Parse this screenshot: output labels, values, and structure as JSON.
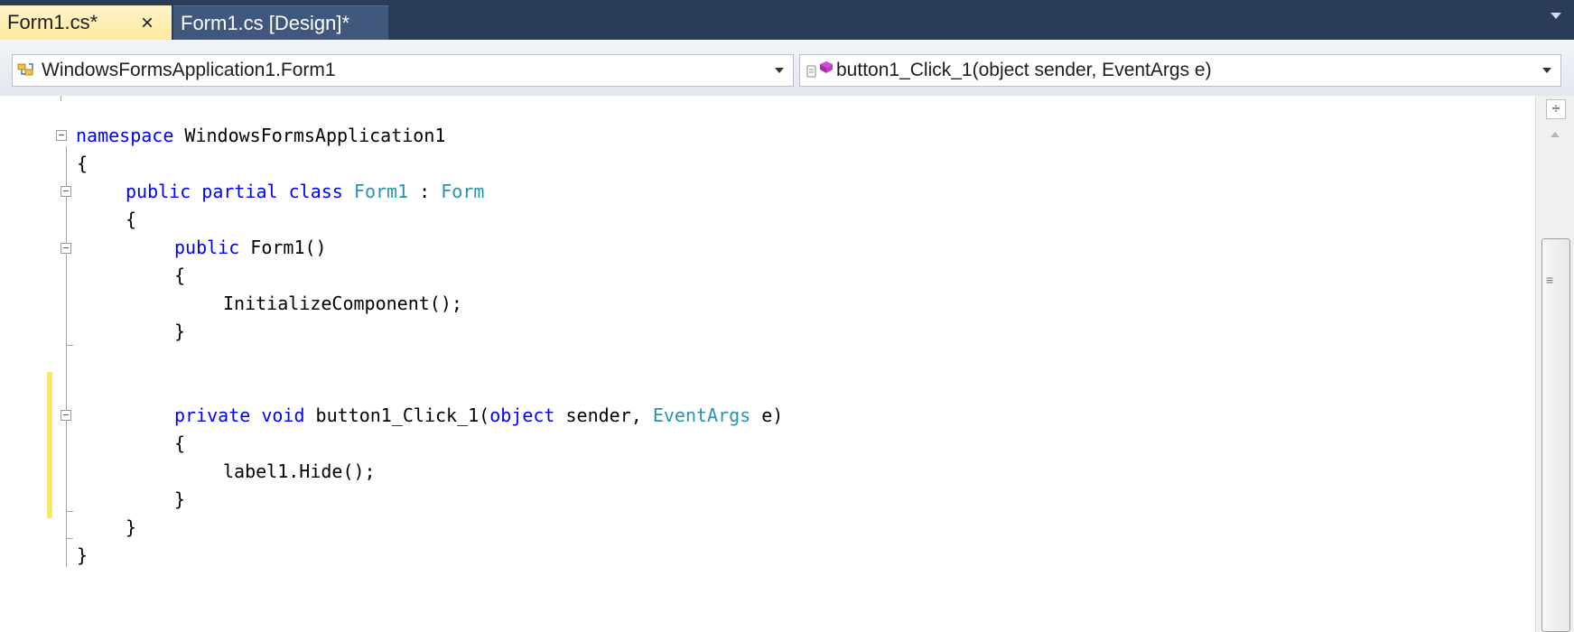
{
  "tabs": [
    {
      "label": "Form1.cs*",
      "active": true,
      "close": "×"
    },
    {
      "label": "Form1.cs [Design]*",
      "active": false
    }
  ],
  "navbar": {
    "class_combo": "WindowsFormsApplication1.Form1",
    "member_combo": "button1_Click_1(object sender, EventArgs e)"
  },
  "code": {
    "line_namespace": {
      "kw": "namespace",
      "rest": " WindowsFormsApplication1"
    },
    "brace_open_ns": "{",
    "line_class": {
      "kw1": "public",
      "kw2": "partial",
      "kw3": "class",
      "name": "Form1",
      "colon": " : ",
      "base": "Form"
    },
    "brace_open_class": "{",
    "line_ctor": {
      "kw": "public",
      "rest": " Form1()"
    },
    "brace_open_ctor": "{",
    "line_init": "InitializeComponent();",
    "brace_close_ctor": "}",
    "line_method": {
      "kw1": "private",
      "kw2": "void",
      "name": " button1_Click_1(",
      "kw3": "object",
      "mid": " sender, ",
      "type": "EventArgs",
      "end": " e)"
    },
    "brace_open_method": "{",
    "line_hide": "label1.Hide();",
    "brace_close_method": "}",
    "brace_close_class": "}",
    "brace_close_ns": "}"
  },
  "icons": {
    "tab_close": "close-icon",
    "class_combo": "class-icon",
    "member_combo": "method-icon",
    "split": "split-window-icon"
  },
  "colors": {
    "keyword": "#0000ff",
    "type": "#2b91af",
    "tab_active": "#ffe9a0",
    "tabbar": "#2b3c59"
  },
  "scrollbar": {
    "split_glyph": "÷",
    "grip_glyph": "≡"
  }
}
